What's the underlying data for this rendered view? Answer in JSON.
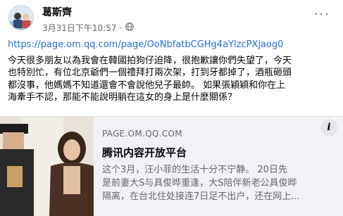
{
  "post": {
    "author_name": "葛斯齊",
    "timestamp": "3月31日下午10:57 · ",
    "privacy_icon": "globe-icon",
    "more_icon": "more-options-icon",
    "link_url": "https://page.om.qq.com/page/OoNbfatbCGHg4aYlzcPXjaog0",
    "body_text": "今天很多朋友以為我會在韓國拍狗仔迫降，很抱歉讓你們失望了，今天\n也特別忙，有位北京爺們一個禮拜打兩次架，打到牙都掉了，酒瓶砸頭\n都沒事，他媽媽不知道還會不會說他兒子最帥。 如果張穎穎和你在上\n海牽手不認，那能不能說明躺在這女的身上是什麼關係？"
  },
  "link_card": {
    "domain": "PAGE.OM.QQ.COM",
    "title": "腾讯内容开放平台",
    "description": "这个3月，汪小菲的生活十分不宁静。        20日先\n是前妻大S与具俊晔重逢，大S陪伴新老公具俊晔\n隔离，在台北住处接连7日足不出户，还在网上...",
    "info_icon": "info-icon"
  },
  "colors": {
    "link": "#216fdb",
    "card_bg": "#f0f2f5",
    "secondary_text": "#65676b"
  }
}
